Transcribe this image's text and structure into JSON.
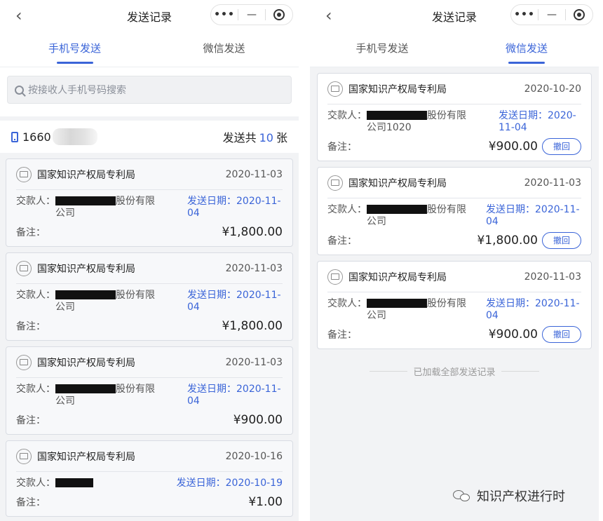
{
  "left": {
    "nav": {
      "back": "‹",
      "title": "发送记录",
      "dots": "•••",
      "minimize": "—"
    },
    "tabs": [
      {
        "label": "手机号发送",
        "active": true
      },
      {
        "label": "微信发送",
        "active": false
      }
    ],
    "search_placeholder": "按接收人手机号码搜索",
    "summary": {
      "phone": "1660",
      "prefix": "发送共",
      "count": "10",
      "suffix": "张"
    },
    "cards": [
      {
        "org": "国家知识产权局专利局",
        "date": "2020-11-03",
        "payer_label": "交款人：",
        "payer_text": "股份有限公司",
        "send_date_label": "发送日期：",
        "send_date": "2020-11-04",
        "remark_label": "备注：",
        "amount": "¥1,800.00"
      },
      {
        "org": "国家知识产权局专利局",
        "date": "2020-11-03",
        "payer_label": "交款人：",
        "payer_text": "股份有限公司",
        "send_date_label": "发送日期：",
        "send_date": "2020-11-04",
        "remark_label": "备注：",
        "amount": "¥1,800.00"
      },
      {
        "org": "国家知识产权局专利局",
        "date": "2020-11-03",
        "payer_label": "交款人：",
        "payer_text": "股份有限公司",
        "send_date_label": "发送日期：",
        "send_date": "2020-11-04",
        "remark_label": "备注：",
        "amount": "¥900.00"
      },
      {
        "org": "国家知识产权局专利局",
        "date": "2020-10-16",
        "payer_label": "交款人：",
        "payer_text": "",
        "send_date_label": "发送日期：",
        "send_date": "2020-10-19",
        "remark_label": "备注：",
        "amount": "¥1.00"
      }
    ]
  },
  "right": {
    "nav": {
      "back": "‹",
      "title": "发送记录",
      "dots": "•••",
      "minimize": "—"
    },
    "tabs": [
      {
        "label": "手机号发送",
        "active": false
      },
      {
        "label": "微信发送",
        "active": true
      }
    ],
    "cards": [
      {
        "org": "国家知识产权局专利局",
        "date": "2020-10-20",
        "payer_label": "交款人：",
        "payer_text": "股份有限公司1020",
        "send_date_label": "发送日期：",
        "send_date": "2020-11-04",
        "remark_label": "备注：",
        "amount": "¥900.00",
        "revoke": "撤回"
      },
      {
        "org": "国家知识产权局专利局",
        "date": "2020-11-03",
        "payer_label": "交款人：",
        "payer_text": "股份有限公司",
        "send_date_label": "发送日期：",
        "send_date": "2020-11-04",
        "remark_label": "备注：",
        "amount": "¥1,800.00",
        "revoke": "撤回"
      },
      {
        "org": "国家知识产权局专利局",
        "date": "2020-11-03",
        "payer_label": "交款人：",
        "payer_text": "股份有限公司",
        "send_date_label": "发送日期：",
        "send_date": "2020-11-04",
        "remark_label": "备注：",
        "amount": "¥900.00",
        "revoke": "撤回"
      }
    ],
    "footer_note": "已加载全部发送记录"
  },
  "watermark": "知识产权进行时",
  "colors": {
    "accent": "#3a64d8",
    "page_bg": "#f2f3f5"
  }
}
